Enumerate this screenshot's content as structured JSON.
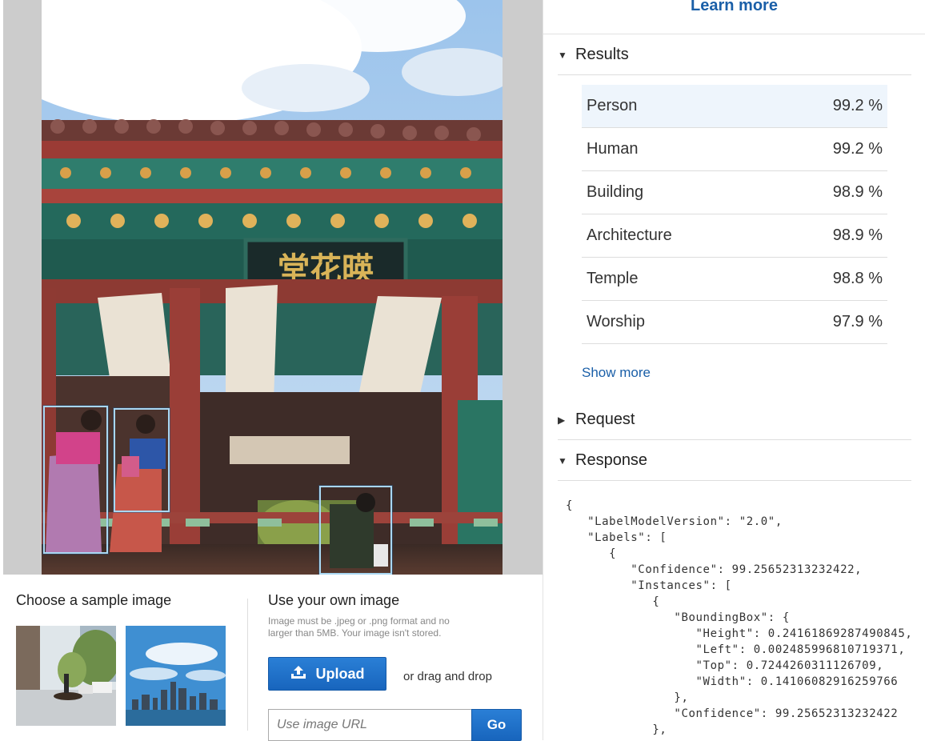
{
  "header": {
    "learn_more": "Learn more"
  },
  "results": {
    "title": "Results",
    "items": [
      {
        "label": "Person",
        "value": "99.2 %"
      },
      {
        "label": "Human",
        "value": "99.2 %"
      },
      {
        "label": "Building",
        "value": "98.9 %"
      },
      {
        "label": "Architecture",
        "value": "98.9 %"
      },
      {
        "label": "Temple",
        "value": "98.8 %"
      },
      {
        "label": "Worship",
        "value": "97.9 %"
      }
    ],
    "show_more": "Show more"
  },
  "request": {
    "title": "Request"
  },
  "response": {
    "title": "Response",
    "json_text": "{\n   \"LabelModelVersion\": \"2.0\",\n   \"Labels\": [\n      {\n         \"Confidence\": 99.25652313232422,\n         \"Instances\": [\n            {\n               \"BoundingBox\": {\n                  \"Height\": 0.24161869287490845,\n                  \"Left\": 0.002485996810719371,\n                  \"Top\": 0.7244260311126709,\n                  \"Width\": 0.14106082916259766\n               },\n               \"Confidence\": 99.25652313232422\n            },"
  },
  "sample": {
    "title": "Choose a sample image"
  },
  "own_image": {
    "title": "Use your own image",
    "note": "Image must be .jpeg or .png format and no larger than 5MB. Your image isn't stored.",
    "upload_label": "Upload",
    "drag_text": "or drag and drop",
    "url_placeholder": "Use image URL",
    "go_label": "Go"
  },
  "signboard": {
    "text": "堂花暎"
  },
  "colors": {
    "accent_blue": "#1a5fa8",
    "button_blue": "#1f6fc9",
    "selected_row": "#eef5fc",
    "bbox_outline": "#a9d7f2"
  },
  "icons": {
    "results_caret": "caret-down-icon",
    "request_caret": "caret-right-icon",
    "response_caret": "caret-down-icon",
    "upload_icon": "upload-icon"
  }
}
